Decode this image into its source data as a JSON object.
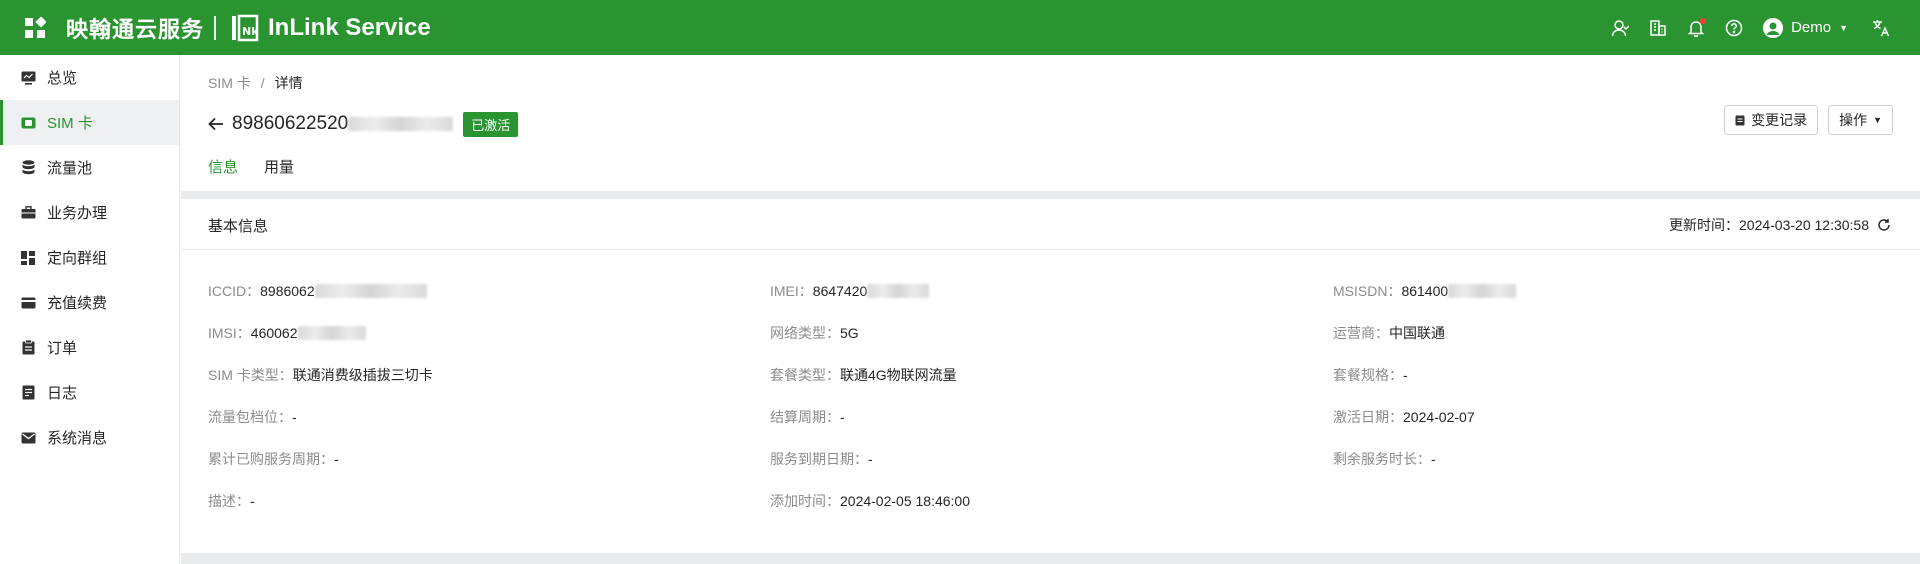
{
  "topbar": {
    "brand_cn": "映翰通云服务",
    "brand_en": "InLink Service",
    "user_name": "Demo"
  },
  "sidebar": {
    "items": [
      {
        "label": "总览",
        "icon": "monitor-icon"
      },
      {
        "label": "SIM 卡",
        "icon": "sim-card-icon"
      },
      {
        "label": "流量池",
        "icon": "database-icon"
      },
      {
        "label": "业务办理",
        "icon": "briefcase-icon"
      },
      {
        "label": "定向群组",
        "icon": "group-grid-icon"
      },
      {
        "label": "充值续费",
        "icon": "card-icon"
      },
      {
        "label": "订单",
        "icon": "order-icon"
      },
      {
        "label": "日志",
        "icon": "log-icon"
      },
      {
        "label": "系统消息",
        "icon": "mail-icon"
      }
    ],
    "active_index": 1
  },
  "breadcrumb": {
    "parent": "SIM 卡",
    "separator": "/",
    "current": "详情"
  },
  "header": {
    "iccid_visible": "89860622520",
    "status": "已激活",
    "history_button": "变更记录",
    "actions_button": "操作"
  },
  "tabs": [
    {
      "label": "信息",
      "active": true
    },
    {
      "label": "用量",
      "active": false
    }
  ],
  "section": {
    "title": "基本信息",
    "update_label": "更新时间：",
    "update_value": "2024-03-20 12:30:58"
  },
  "fields": [
    [
      {
        "label": "ICCID：",
        "value": "8986062",
        "masked": true
      },
      {
        "label": "IMEI：",
        "value": "8647420",
        "masked": true
      },
      {
        "label": "MSISDN：",
        "value": "861400",
        "masked": true
      }
    ],
    [
      {
        "label": "IMSI：",
        "value": "460062",
        "masked": true
      },
      {
        "label": "网络类型：",
        "value": "5G",
        "masked": false
      },
      {
        "label": "运营商：",
        "value": "中国联通",
        "masked": false
      }
    ],
    [
      {
        "label": "SIM 卡类型：",
        "value": "联通消费级插拔三切卡",
        "masked": false
      },
      {
        "label": "套餐类型：",
        "value": "联通4G物联网流量",
        "masked": false
      },
      {
        "label": "套餐规格：",
        "value": "-",
        "masked": false
      }
    ],
    [
      {
        "label": "流量包档位：",
        "value": "-",
        "masked": false
      },
      {
        "label": "结算周期：",
        "value": "-",
        "masked": false
      },
      {
        "label": "激活日期：",
        "value": "2024-02-07",
        "masked": false
      }
    ],
    [
      {
        "label": "累计已购服务周期：",
        "value": "-",
        "masked": false
      },
      {
        "label": "服务到期日期：",
        "value": "-",
        "masked": false
      },
      {
        "label": "剩余服务时长：",
        "value": "-",
        "masked": false
      }
    ],
    [
      {
        "label": "描述：",
        "value": "-",
        "masked": false
      },
      {
        "label": "添加时间：",
        "value": "2024-02-05 18:46:00",
        "masked": false
      }
    ]
  ],
  "colors": {
    "brand": "#2a9431",
    "label": "#8c8c8c",
    "text": "#262626"
  }
}
